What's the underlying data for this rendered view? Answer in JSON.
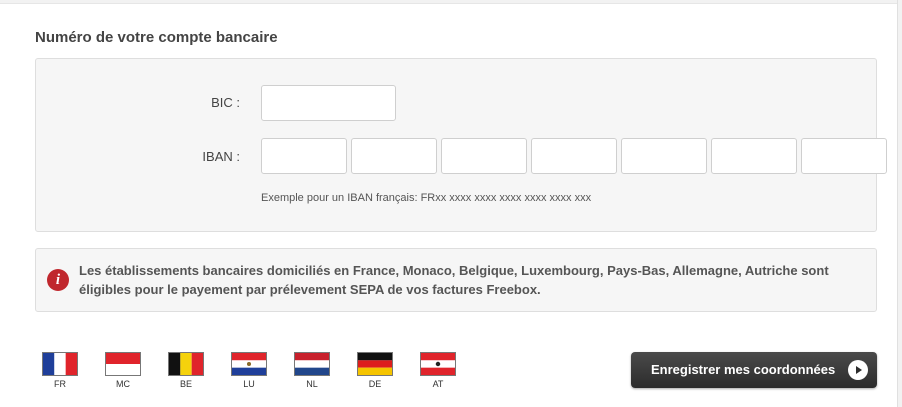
{
  "section": {
    "title": "Numéro de votre compte bancaire"
  },
  "form": {
    "bic_label": "BIC :",
    "iban_label": "IBAN :",
    "bic_value": "",
    "iban_values": [
      "",
      "",
      "",
      "",
      "",
      "",
      ""
    ],
    "hint": "Exemple pour un IBAN français: FRxx xxxx xxxx xxxx xxxx xxxx xxx"
  },
  "info": {
    "icon": "info-icon",
    "icon_glyph": "i",
    "text": "Les établissements bancaires domiciliés en France, Monaco, Belgique, Luxembourg, Pays-Bas, Allemagne, Autriche sont éligibles pour le payement par prélevement SEPA de vos factures Freebox."
  },
  "flags": [
    {
      "code": "FR"
    },
    {
      "code": "MC"
    },
    {
      "code": "BE"
    },
    {
      "code": "LU"
    },
    {
      "code": "NL"
    },
    {
      "code": "DE"
    },
    {
      "code": "AT"
    }
  ],
  "actions": {
    "save_label": "Enregistrer mes coordonnées",
    "save_icon": "play-icon"
  },
  "colors": {
    "info_icon": "#c0272d",
    "button": "#2c2c2c"
  }
}
